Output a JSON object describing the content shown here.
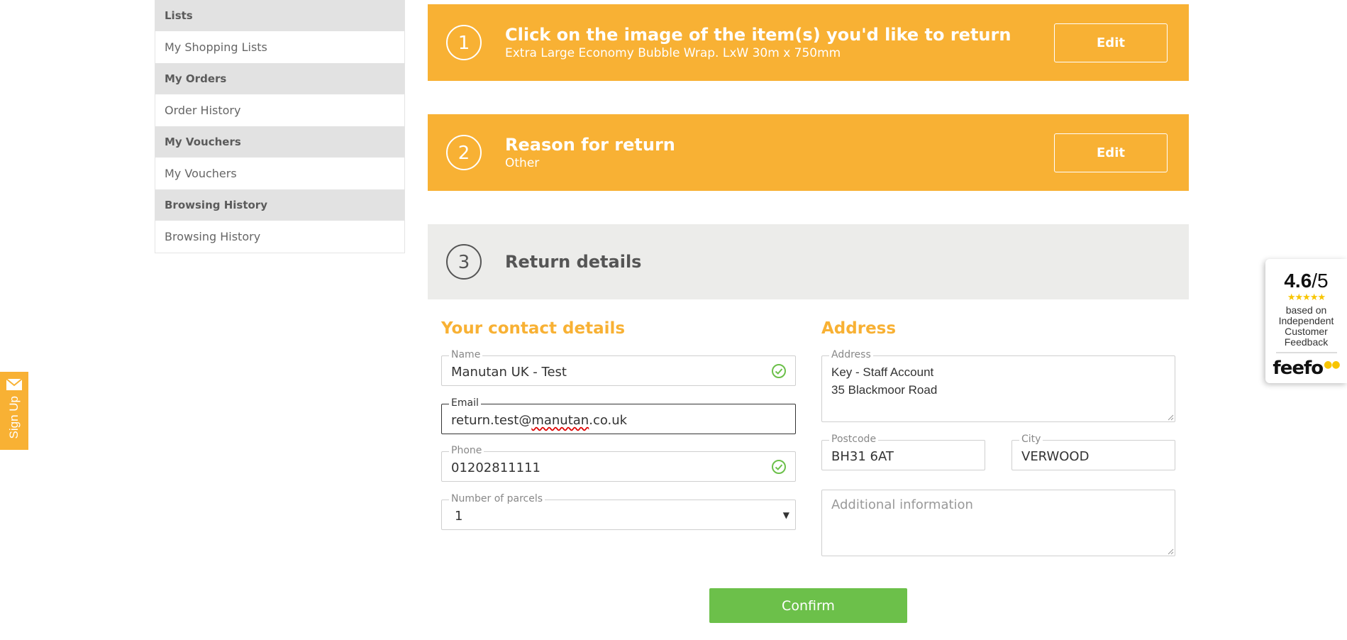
{
  "sidebar": {
    "sections": [
      {
        "heading": "Lists",
        "item": "My Shopping Lists"
      },
      {
        "heading": "My Orders",
        "item": "Order History"
      },
      {
        "heading": "My Vouchers",
        "item": "My Vouchers"
      },
      {
        "heading": "Browsing History",
        "item": "Browsing History"
      }
    ]
  },
  "signup": {
    "label": "Sign Up"
  },
  "steps": [
    {
      "number": "1",
      "title": "Click on the image of the item(s) you'd like to return",
      "subtitle": "Extra Large Economy Bubble Wrap. LxW 30m x 750mm",
      "edit_label": "Edit"
    },
    {
      "number": "2",
      "title": "Reason for return",
      "subtitle": "Other",
      "edit_label": "Edit"
    },
    {
      "number": "3",
      "title": "Return details"
    }
  ],
  "contact": {
    "title": "Your contact details",
    "name": {
      "label": "Name",
      "value": "Manutan UK - Test"
    },
    "email": {
      "label": "Email",
      "value_prefix": "return.test@",
      "value_misspelled": "manutan",
      "value_suffix": ".co.uk"
    },
    "phone": {
      "label": "Phone",
      "value": "01202811111"
    },
    "parcels": {
      "label": "Number of parcels",
      "value": "1"
    }
  },
  "address": {
    "title": "Address",
    "address": {
      "label": "Address",
      "line1": "Key - Staff Account",
      "line2": "35 Blackmoor Road"
    },
    "postcode": {
      "label": "Postcode",
      "value": "BH31 6AT"
    },
    "city": {
      "label": "City",
      "value": "VERWOOD"
    },
    "additional": {
      "placeholder": "Additional information"
    }
  },
  "confirm_label": "Confirm",
  "feefo": {
    "score": "4.6",
    "out_of": "/5",
    "stars": "★★★★★",
    "line1": "based on",
    "line2": "Independent",
    "line3": "Customer",
    "line4": "Feedback",
    "logo": "feefo",
    "logo_eyes": "●●"
  },
  "colors": {
    "accent": "#f8b134",
    "confirm": "#6cc04a",
    "check": "#6cc04a"
  }
}
